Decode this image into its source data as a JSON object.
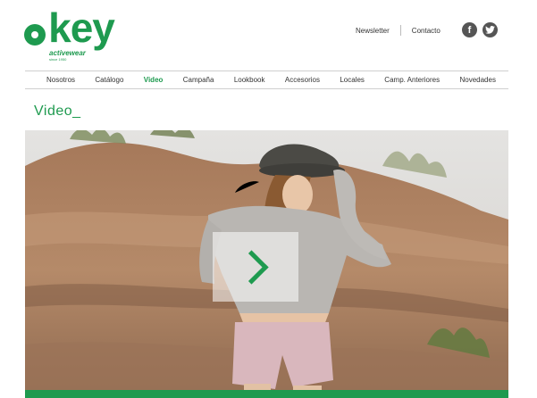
{
  "brand": {
    "name": "okey",
    "tagline": "activewear",
    "since": "since 1950",
    "color": "#1e9a4f"
  },
  "top_links": {
    "newsletter": "Newsletter",
    "contact": "Contacto",
    "social": [
      "facebook-icon",
      "twitter-icon"
    ]
  },
  "nav": {
    "items": [
      "Nosotros",
      "Catálogo",
      "Video",
      "Campaña",
      "Lookbook",
      "Accesorios",
      "Locales",
      "Camp. Anteriores",
      "Novedades"
    ],
    "active": "Video"
  },
  "page": {
    "title": "Video_"
  },
  "video": {
    "play_icon": "play-chevron-icon"
  }
}
